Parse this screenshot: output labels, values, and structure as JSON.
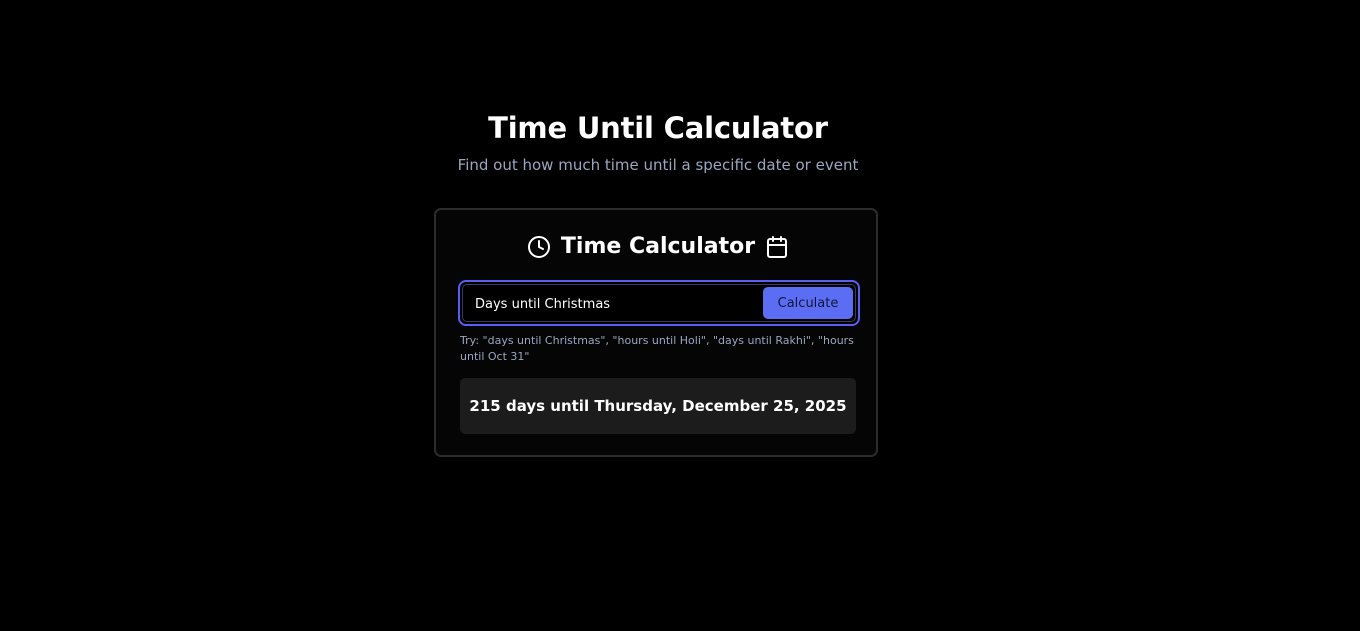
{
  "header": {
    "title": "Time Until Calculator",
    "subtitle": "Find out how much time until a specific date or event"
  },
  "card": {
    "title": "Time Calculator",
    "left_icon": "clock-icon",
    "right_icon": "calendar-icon"
  },
  "query": {
    "value": "Days until Christmas",
    "button_label": "Calculate",
    "accent_color": "#5b6df2",
    "focus_border_color": "#5b5ef2"
  },
  "hint": {
    "text": "Try: \"days until Christmas\", \"hours until Holi\", \"days until Rakhi\", \"hours until Oct 31\""
  },
  "result": {
    "text": "215 days until Thursday, December 25, 2025"
  },
  "colors": {
    "background": "#000000",
    "card_border": "#2c2c2c",
    "result_background": "#1c1c1c",
    "muted_text": "#9aa6c0"
  }
}
